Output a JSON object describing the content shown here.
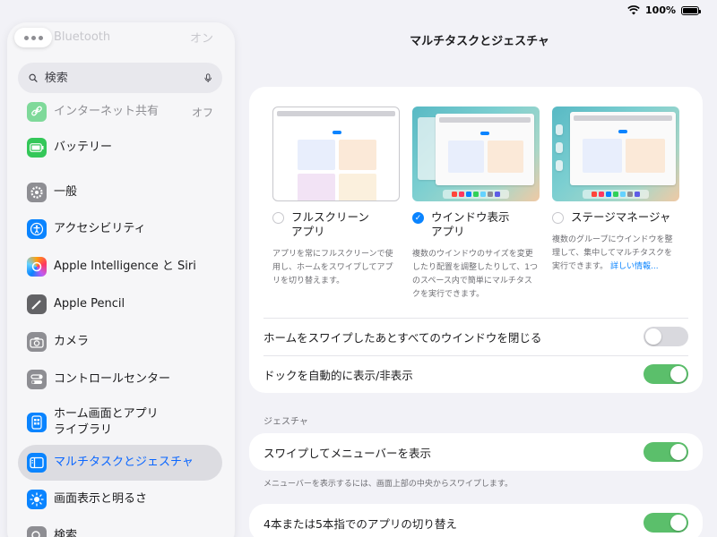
{
  "status": {
    "battery_text": "100%",
    "battery_level": 1.0
  },
  "sidebar": {
    "ghost_item": {
      "label": "Bluetooth",
      "value": "オン"
    },
    "search": {
      "placeholder": "検索"
    },
    "items": [
      {
        "label": "インターネット共有",
        "value": "オフ",
        "icon": "link-icon",
        "color": "#34c759"
      },
      {
        "label": "バッテリー",
        "icon": "battery-icon",
        "color": "#34c759"
      },
      {
        "label": "一般",
        "icon": "gear-icon",
        "color": "#8e8e93"
      },
      {
        "label": "アクセシビリティ",
        "icon": "accessibility-icon",
        "color": "#0a84ff"
      },
      {
        "label": "Apple Intelligence と Siri",
        "icon": "siri-icon",
        "color": "#ff6b6b"
      },
      {
        "label": "Apple Pencil",
        "icon": "pencil-icon",
        "color": "#636366"
      },
      {
        "label": "カメラ",
        "icon": "camera-icon",
        "color": "#8e8e93"
      },
      {
        "label": "コントロールセンター",
        "icon": "control-center-icon",
        "color": "#8e8e93"
      },
      {
        "label": "ホーム画面とアプリ\nライブラリ",
        "icon": "home-screen-icon",
        "color": "#0a84ff"
      },
      {
        "label": "マルチタスクとジェスチャ",
        "icon": "multitasking-icon",
        "color": "#0a84ff"
      },
      {
        "label": "画面表示と明るさ",
        "icon": "brightness-icon",
        "color": "#0a84ff"
      },
      {
        "label": "検索",
        "icon": "search-icon",
        "color": "#8e8e93"
      }
    ]
  },
  "main": {
    "title": "マルチタスクとジェスチャ",
    "modes": [
      {
        "label": "フルスクリーン\nアプリ",
        "selected": false,
        "description": "アプリを常にフルスクリーンで使用し、ホームをスワイプしてアプリを切り替えます。"
      },
      {
        "label": "ウインドウ表示\nアプリ",
        "selected": true,
        "description": "複数のウインドウのサイズを変更したり配置を調整したりして、1つのスペース内で簡単にマルチタスクを実行できます。"
      },
      {
        "label": "ステージマネージャ",
        "selected": false,
        "description": "複数のグループにウインドウを整理して、集中してマルチタスクを実行できます。",
        "link": "詳しい情報..."
      }
    ],
    "toggles": [
      {
        "label": "ホームをスワイプしたあとすべてのウインドウを閉じる",
        "on": false
      },
      {
        "label": "ドックを自動的に表示/非表示",
        "on": true
      }
    ],
    "gestures_header": "ジェスチャ",
    "gesture_toggles": [
      {
        "label": "スワイプしてメニューバーを表示",
        "on": true,
        "footnote": "メニューバーを表示するには、画面上部の中央からスワイプします。"
      },
      {
        "label": "4本または5本指でのアプリの切り替え",
        "on": true
      }
    ]
  }
}
